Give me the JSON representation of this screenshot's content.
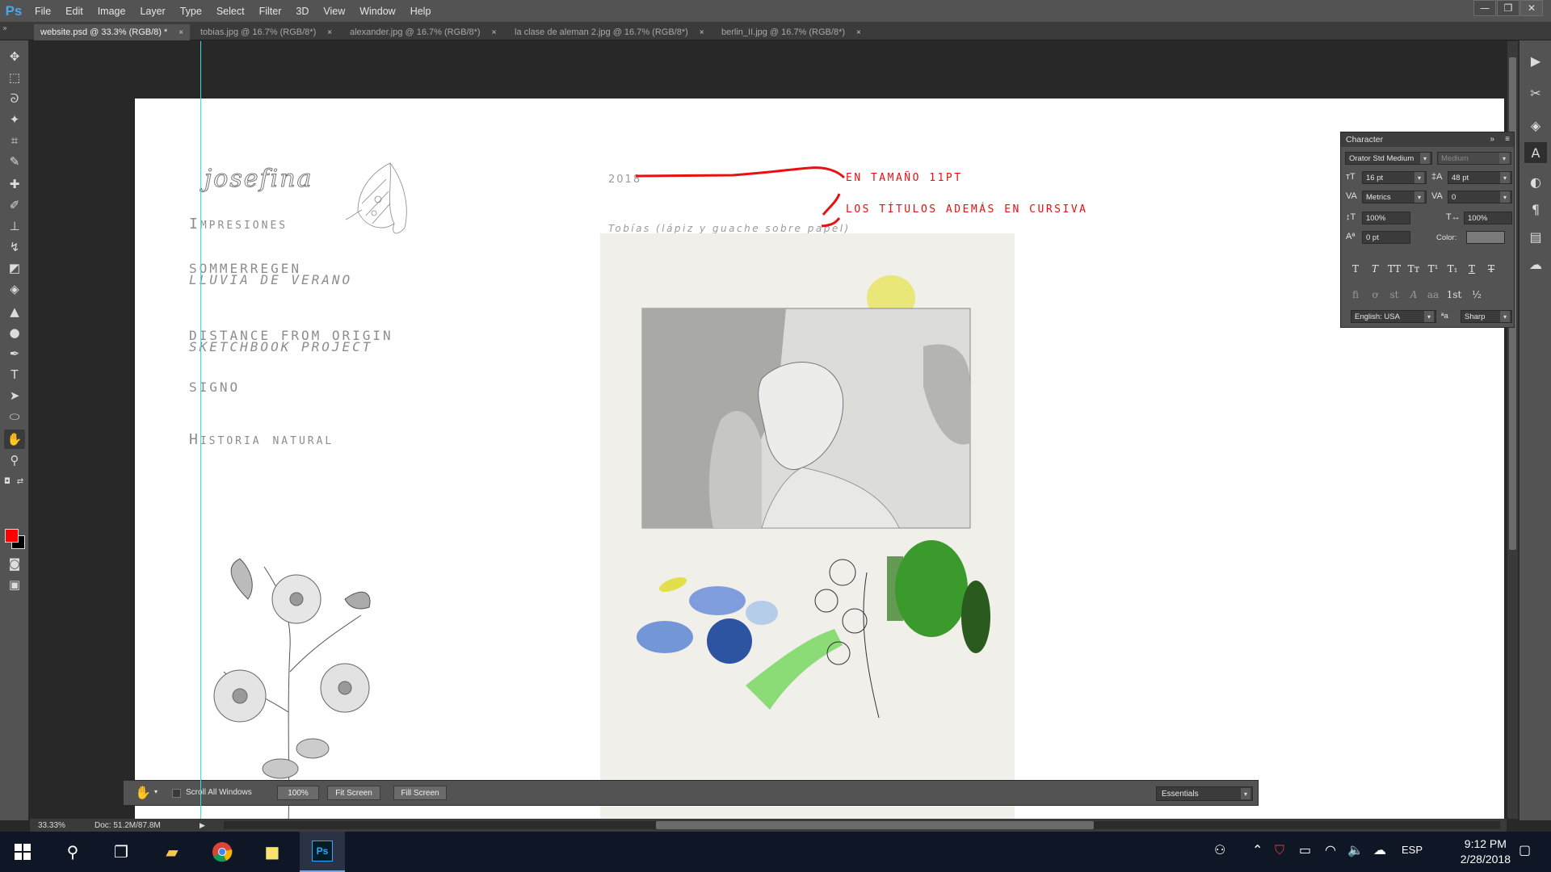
{
  "app": {
    "logo": "Ps"
  },
  "menu": [
    "File",
    "Edit",
    "Image",
    "Layer",
    "Type",
    "Select",
    "Filter",
    "3D",
    "View",
    "Window",
    "Help"
  ],
  "window_controls": {
    "minimize": "—",
    "restore": "❐",
    "close": "✕"
  },
  "tabs": [
    {
      "label": "website.psd @ 33.3% (RGB/8) *",
      "active": true
    },
    {
      "label": "tobias.jpg @ 16.7% (RGB/8*)",
      "active": false
    },
    {
      "label": "alexander.jpg @ 16.7% (RGB/8*)",
      "active": false
    },
    {
      "label": "la clase de aleman 2.jpg @ 16.7% (RGB/8*)",
      "active": false
    },
    {
      "label": "berlin_II.jpg @ 16.7% (RGB/8*)",
      "active": false
    }
  ],
  "tab_close": "×",
  "tools": [
    "move-tool",
    "marquee-tool",
    "lasso-tool",
    "magic-wand-tool",
    "crop-tool",
    "eyedropper-tool",
    "healing-tool",
    "brush-tool",
    "stamp-tool",
    "history-brush-tool",
    "eraser-tool",
    "paint-bucket-tool",
    "blur-tool",
    "dodge-tool",
    "pen-tool",
    "type-tool",
    "path-selection-tool",
    "ellipse-tool",
    "hand-tool",
    "zoom-tool"
  ],
  "colors": {
    "foreground": "#ff0000",
    "background": "#000000",
    "annotation": "#e81010",
    "guide": "#3fd7e6"
  },
  "document": {
    "site_name": "josefina",
    "nav": [
      {
        "title": "Impresiones",
        "subtitle": ""
      },
      {
        "title": "SOMMERREGEN",
        "subtitle": "LLUVIA DE VERANO"
      },
      {
        "title": "DISTANCE FROM ORIGIN",
        "subtitle": "SKETCHBOOK PROJECT"
      },
      {
        "title": "SIGNO",
        "subtitle": ""
      },
      {
        "title": "Historia natural",
        "subtitle": ""
      }
    ],
    "year": "2018",
    "caption": "Tobías (lápiz y guache sobre papel)",
    "annotations": {
      "size_note": "EN TAMAÑO 11PT",
      "italic_note": "LOS TÍTULOS ADEMÁS EN CURSIVA"
    }
  },
  "status": {
    "zoom": "33.33%",
    "doc_size": "Doc: 51.2M/87.8M"
  },
  "character_panel": {
    "title": "Character",
    "font_family": "Orator Std Medium",
    "font_style": "Medium",
    "font_size": "16 pt",
    "leading": "48 pt",
    "kerning": "Metrics",
    "tracking": "0",
    "vertical_scale": "100%",
    "horizontal_scale": "100%",
    "baseline_shift": "0 pt",
    "color_label": "Color:",
    "language": "English: USA",
    "aa_label": "ªa",
    "anti_alias": "Sharp",
    "style_buttons": [
      "T",
      "T",
      "TT",
      "Tт",
      "T¹",
      "T₁",
      "T",
      "T"
    ],
    "opentype_buttons": [
      "ﬁ",
      "ơ",
      "st",
      "A",
      "aa",
      "1st",
      "½"
    ]
  },
  "options_bar": {
    "scroll_all_label": "Scroll All Windows",
    "btn_100": "100%",
    "btn_fit": "Fit Screen",
    "btn_fill": "Fill Screen",
    "workspace": "Essentials"
  },
  "taskbar": {
    "time": "9:12 PM",
    "date": "2/28/2018",
    "language": "ESP"
  }
}
